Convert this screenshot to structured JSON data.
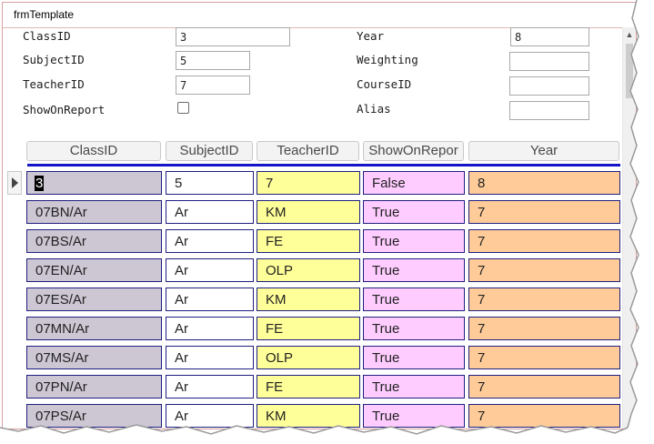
{
  "window": {
    "title": "frmTemplate"
  },
  "form": {
    "fields": [
      {
        "label": "ClassID",
        "value": "3"
      },
      {
        "label": "SubjectID",
        "value": "5"
      },
      {
        "label": "TeacherID",
        "value": "7"
      },
      {
        "label": "ShowOnReport",
        "checked": false
      },
      {
        "label": "Year",
        "value": "8"
      },
      {
        "label": "Weighting",
        "value": ""
      },
      {
        "label": "CourseID",
        "value": ""
      },
      {
        "label": "Alias",
        "value": ""
      }
    ]
  },
  "grid": {
    "headers": [
      "ClassID",
      "SubjectID",
      "TeacherID",
      "ShowOnRepor",
      "Year"
    ],
    "rows": [
      [
        "3",
        "5",
        "7",
        "False",
        "8"
      ],
      [
        "07BN/Ar",
        "Ar",
        "KM",
        "True",
        "7"
      ],
      [
        "07BS/Ar",
        "Ar",
        "FE",
        "True",
        "7"
      ],
      [
        "07EN/Ar",
        "Ar",
        "OLP",
        "True",
        "7"
      ],
      [
        "07ES/Ar",
        "Ar",
        "KM",
        "True",
        "7"
      ],
      [
        "07MN/Ar",
        "Ar",
        "FE",
        "True",
        "7"
      ],
      [
        "07MS/Ar",
        "Ar",
        "OLP",
        "True",
        "7"
      ],
      [
        "07PN/Ar",
        "Ar",
        "FE",
        "True",
        "7"
      ],
      [
        "07PS/Ar",
        "Ar",
        "KM",
        "True",
        "7"
      ]
    ]
  },
  "colors": {
    "classid": "#cdc6d3",
    "subjectid": "#ffffff",
    "teacherid": "#ffff99",
    "showonreport": "#ffccff",
    "year": "#ffcc99",
    "separator": "#1515c8",
    "cell_border": "#1f1f80"
  },
  "icons": {
    "record_selector": "triangle-right-icon",
    "scroll_up": "chevron-up-icon"
  }
}
